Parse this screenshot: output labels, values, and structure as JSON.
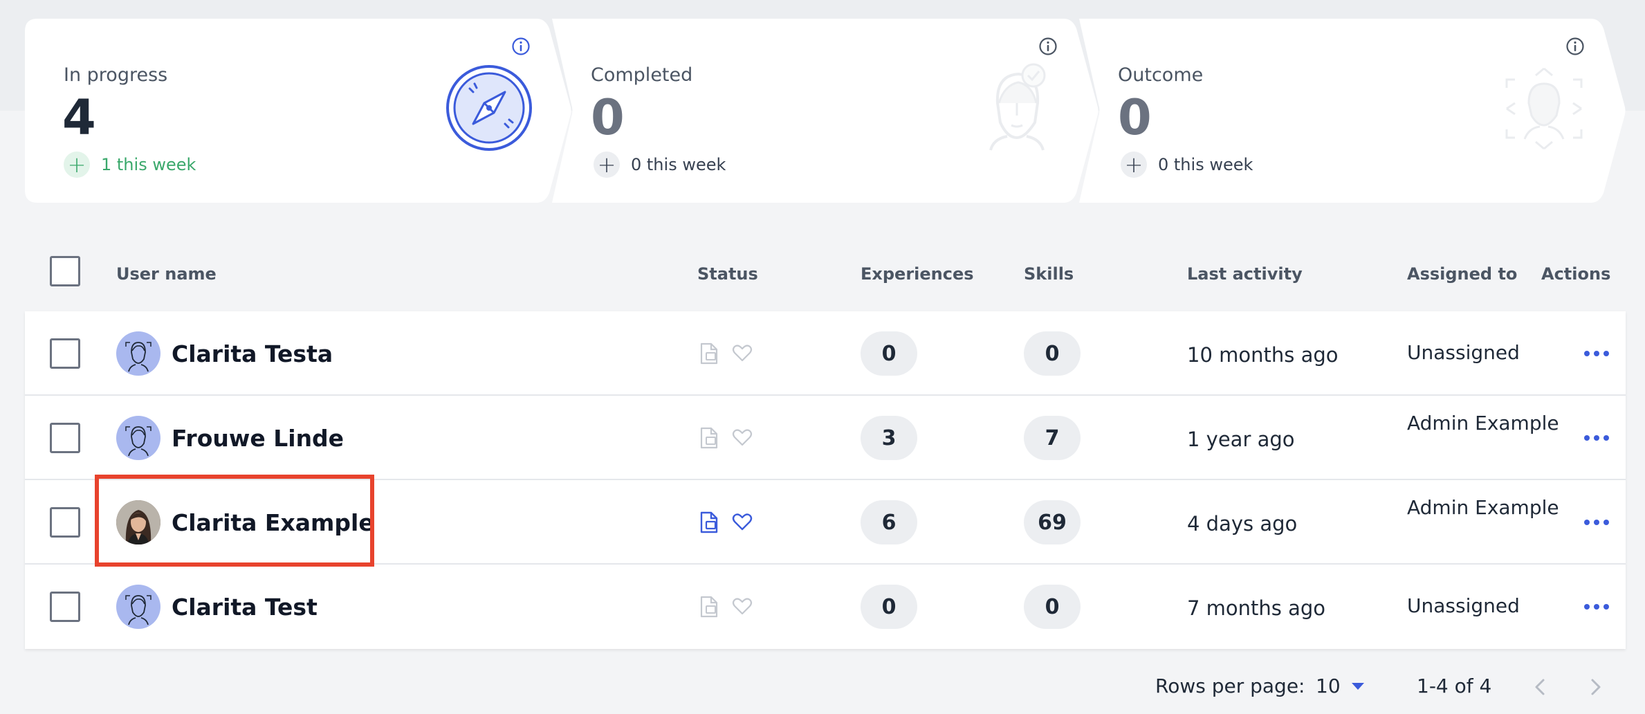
{
  "stats": [
    {
      "label": "In progress",
      "value": "4",
      "delta": "1 this week",
      "icon": "compass-icon"
    },
    {
      "label": "Completed",
      "value": "0",
      "delta": "0 this week",
      "icon": "person-check-icon"
    },
    {
      "label": "Outcome",
      "value": "0",
      "delta": "0 this week",
      "icon": "person-target-icon"
    }
  ],
  "table": {
    "headers": {
      "user_name": "User name",
      "status": "Status",
      "experiences": "Experiences",
      "skills": "Skills",
      "last_activity": "Last activity",
      "assigned_to": "Assigned to",
      "actions": "Actions"
    },
    "rows": [
      {
        "name": "Clarita Testa",
        "avatar": "default-avatar",
        "status_active": false,
        "experiences": "0",
        "skills": "0",
        "last_activity": "10 months ago",
        "assigned_to": "Unassigned"
      },
      {
        "name": "Frouwe Linde",
        "avatar": "default-avatar",
        "status_active": false,
        "experiences": "3",
        "skills": "7",
        "last_activity": "1 year ago",
        "assigned_to": "Admin Example"
      },
      {
        "name": "Clarita Example",
        "avatar": "photo-avatar",
        "status_active": true,
        "experiences": "6",
        "skills": "69",
        "last_activity": "4 days ago",
        "assigned_to": "Admin Example"
      },
      {
        "name": "Clarita Test",
        "avatar": "default-avatar",
        "status_active": false,
        "experiences": "0",
        "skills": "0",
        "last_activity": "7 months ago",
        "assigned_to": "Unassigned"
      }
    ]
  },
  "pagination": {
    "rows_per_page_label": "Rows per page:",
    "rows_per_page_value": "10",
    "range": "1-4 of 4"
  },
  "colors": {
    "accent": "#3b5bdb",
    "positive": "#3aa86b",
    "highlight": "#e8432d"
  }
}
